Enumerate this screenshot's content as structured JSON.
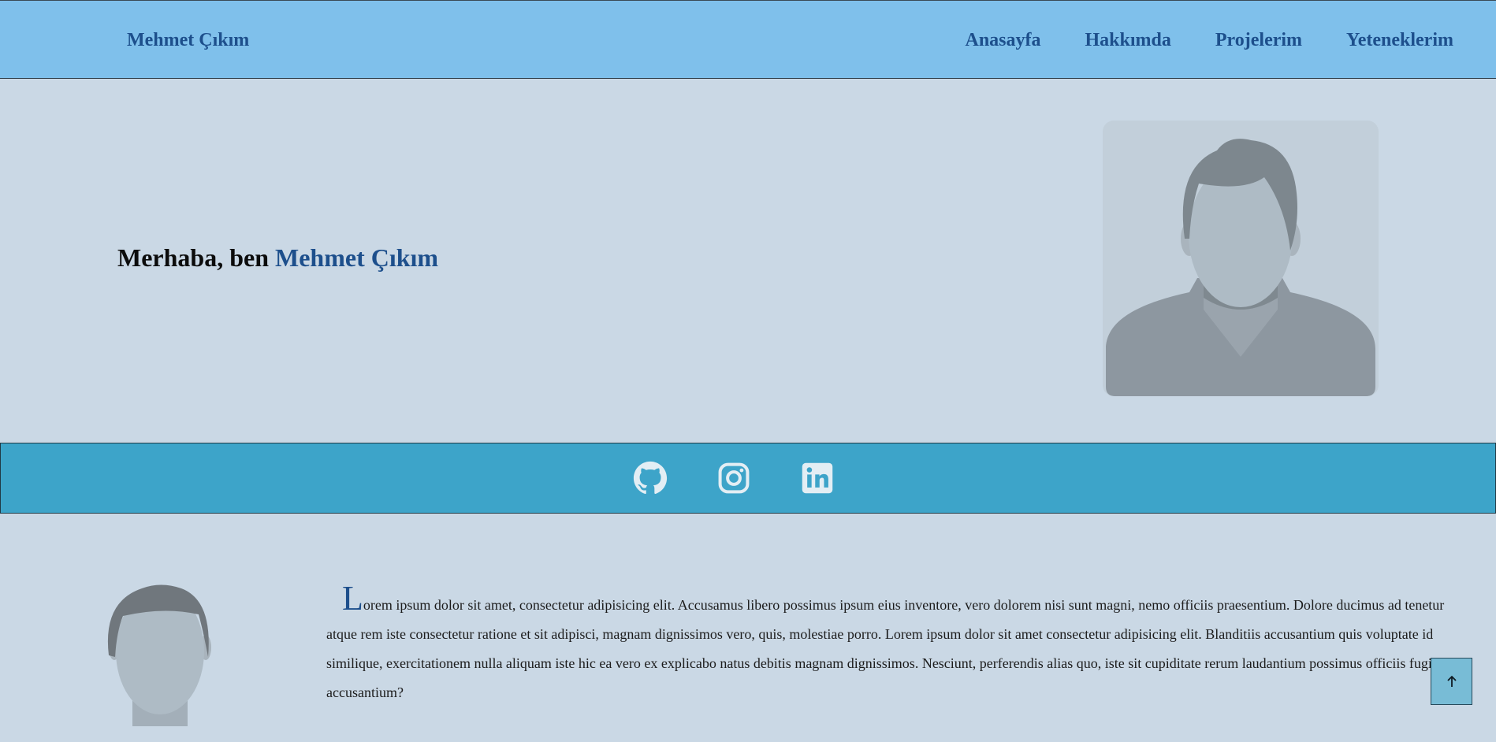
{
  "navbar": {
    "brand": "Mehmet Çıkım",
    "links": [
      "Anasayfa",
      "Hakkımda",
      "Projelerim",
      "Yeteneklerim"
    ]
  },
  "hero": {
    "greeting": "Merhaba, ben",
    "name": "Mehmet Çıkım",
    "avatar_icon": "user-avatar-placeholder"
  },
  "social": {
    "icons": [
      "github-icon",
      "instagram-icon",
      "linkedin-icon"
    ]
  },
  "about": {
    "dropcap": "L",
    "text": "orem ipsum dolor sit amet, consectetur adipisicing elit. Accusamus libero possimus ipsum eius inventore, vero dolorem nisi sunt magni, nemo officiis praesentium. Dolore ducimus ad tenetur atque rem iste consectetur ratione et sit adipisci, magnam dignissimos vero, quis, molestiae porro. Lorem ipsum dolor sit amet consectetur adipisicing elit. Blanditiis accusantium quis voluptate id similique, exercitationem nulla aliquam iste hic ea vero ex explicabo natus debitis magnam dignissimos. Nesciunt, perferendis alias quo, iste sit cupiditate rerum laudantium possimus officiis fugit accusantium?"
  },
  "back_to_top": {
    "icon": "arrow-up-icon"
  },
  "colors": {
    "background": "#cad8e5",
    "navbar": "#7fc0eb",
    "accent": "#1d4f8c",
    "social_bar": "#3da4c9",
    "social_icon": "#e3eef4"
  }
}
